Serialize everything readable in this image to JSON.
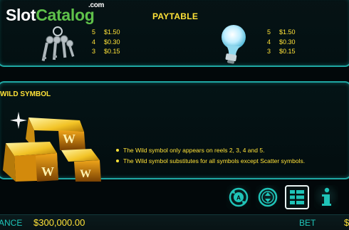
{
  "logo": {
    "slot": "Slot",
    "catalog": "Catalog",
    "dotcom": ".com"
  },
  "paytable": {
    "title": "PAYTABLE",
    "keys_symbol": {
      "icon": "keys-icon",
      "rows": [
        {
          "count": "5",
          "value": "$1.50"
        },
        {
          "count": "4",
          "value": "$0.30"
        },
        {
          "count": "3",
          "value": "$0.15"
        }
      ]
    },
    "bulb_symbol": {
      "icon": "light-bulb-icon",
      "rows": [
        {
          "count": "5",
          "value": "$1.50"
        },
        {
          "count": "4",
          "value": "$0.30"
        },
        {
          "count": "3",
          "value": "$0.15"
        }
      ]
    }
  },
  "wild": {
    "title": "WILD SYMBOL",
    "icon": "gold-bars-wild-icon",
    "bullets": [
      "The Wild symbol only appears on reels 2, 3, 4 and 5.",
      "The Wild symbol substitutes for all symbols except Scatter symbols."
    ]
  },
  "controls": [
    {
      "icon": "autoplay-icon"
    },
    {
      "icon": "bet-coin-icon"
    },
    {
      "icon": "paytable-menu-icon"
    },
    {
      "icon": "info-icon"
    }
  ],
  "status_bar": {
    "balance_label": "ANCE",
    "balance_value": "$300,000.00",
    "bet_label": "BET",
    "bet_value": "$"
  },
  "colors": {
    "accent": "#1fa7a3",
    "text_gold": "#ffe238",
    "label_teal": "#1fc4b8"
  }
}
